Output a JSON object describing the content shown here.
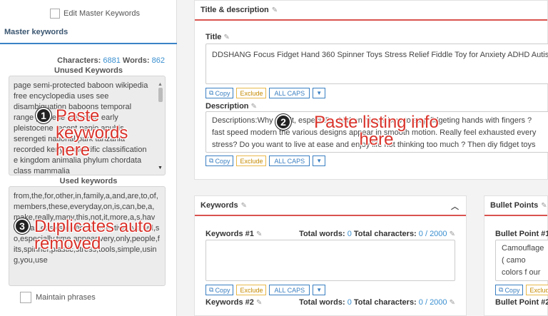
{
  "sidebar": {
    "edit_master_label": "Edit Master Keywords",
    "master_keywords_label": "Master keywords",
    "characters_label": "Characters:",
    "characters_value": "6881",
    "words_label": "Words:",
    "words_value": "862",
    "unused_heading": "Unused Keywords",
    "unused_text": "page semi-protected baboon wikipedia free encyclopedia uses see disambiguation baboons temporal range pliocene holocene early pleistocene recent papio anubis serengeti national park tanzania recorded kenya scientific classification e kingdom animalia phylum chordata class mammalia",
    "used_heading": "Used keywords",
    "used_text": "from,the,for,other,in,family,a,and,are,to,of,members,these,everyday,on,is,can,be,a,make,really,many,this,not,it,more,a,s,have,all,as,easy,stop,fidget,effective,live,will,so,especially,time,appear,very,only,people,fits,spinner,plastic,stress,tools,simple,using,you,use",
    "maintain_label": "Maintain phrases"
  },
  "title_panel": {
    "heading": "Title & description",
    "title_label": "Title",
    "title_value": "DDSHANG Focus Fidget Hand 360 Spinner Toys Stress Relief Fiddle Toy for Anxiety ADHD Autism",
    "description_label": "Description",
    "description_value": "Descriptions:Why use it, especially children? just? how to stop fidgeting hands with fingers ? fast speed modern the various designs appear in smooth motion. Really feel exhausted every stress? Do you want to live at ease and enjoy life not thinking too much ? Then diy fidget toys must"
  },
  "buttons": {
    "copy": "Copy",
    "exclude": "Exclude",
    "all_caps": "ALL CAPS",
    "dropdown": "▼"
  },
  "keywords_panel": {
    "heading": "Keywords",
    "kw1_label": "Keywords #1",
    "kw2_label": "Keywords #2",
    "total_words_label": "Total words:",
    "total_words_value": "0",
    "total_chars_label": "Total characters:",
    "total_chars_value": "0 / 2000"
  },
  "bullets_panel": {
    "heading": "Bullet Points",
    "bp1_label": "Bullet Point #1",
    "bp1_text": "Camouflage ( camo colors f our shop",
    "bp2_label": "Bullet Point #2"
  },
  "annotations": {
    "a1_num": "1",
    "a1_text": "Paste keywords here",
    "a2_num": "2",
    "a2_text": "Paste listing info here",
    "a3_num": "3",
    "a3_text": "Duplicates auto removed"
  },
  "colors": {
    "accent_blue": "#3a8fd0",
    "accent_red": "#d9534f",
    "annotation_red": "#d9322a"
  }
}
